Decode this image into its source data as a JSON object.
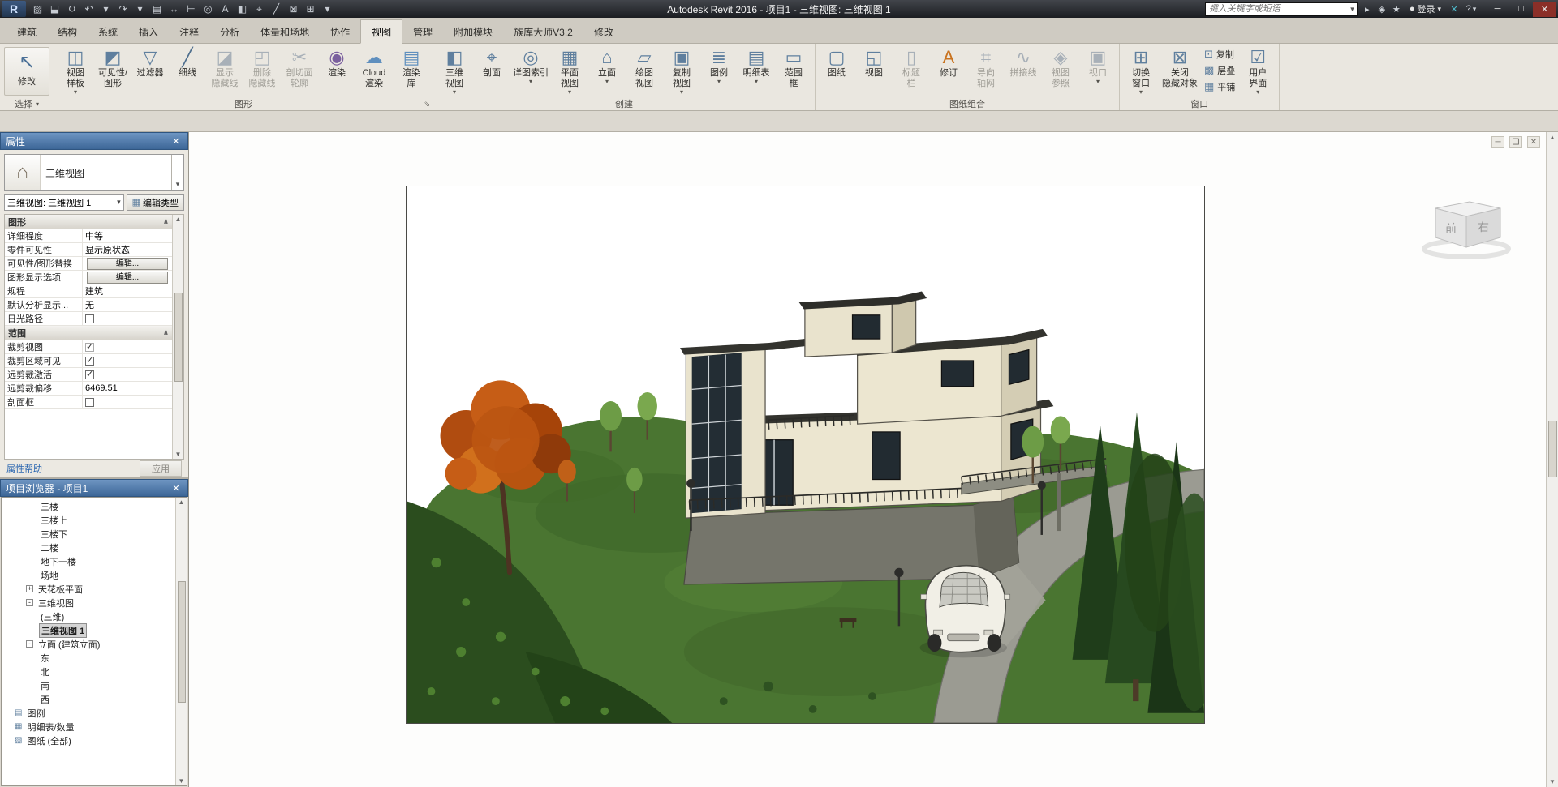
{
  "titlebar": {
    "title": "Autodesk Revit 2016 -   项目1 - 三维视图: 三维视图 1",
    "logo": "R",
    "qat": [
      {
        "icon": "open-icon",
        "glyph": "▨"
      },
      {
        "icon": "save-icon",
        "glyph": "⬓"
      },
      {
        "icon": "sync-icon",
        "glyph": "↻"
      },
      {
        "icon": "undo-icon",
        "glyph": "↶"
      },
      {
        "icon": "undo-caret-icon",
        "glyph": "▾"
      },
      {
        "icon": "redo-icon",
        "glyph": "↷"
      },
      {
        "icon": "redo-caret-icon",
        "glyph": "▾"
      },
      {
        "icon": "print-icon",
        "glyph": "▤"
      },
      {
        "icon": "measure-icon",
        "glyph": "↔"
      },
      {
        "icon": "aligned-dimension-icon",
        "glyph": "⊢"
      },
      {
        "icon": "tag-icon",
        "glyph": "◎"
      },
      {
        "icon": "text-icon",
        "glyph": "A"
      },
      {
        "icon": "default-3d-view-icon",
        "glyph": "◧"
      },
      {
        "icon": "section-icon",
        "glyph": "⌖"
      },
      {
        "icon": "thin-lines-icon",
        "glyph": "╱"
      },
      {
        "icon": "close-hidden-windows-icon",
        "glyph": "⊠"
      },
      {
        "icon": "switch-windows-icon",
        "glyph": "⊞"
      },
      {
        "icon": "qat-customize-icon",
        "glyph": "▾"
      }
    ],
    "search": {
      "placeholder": "键入关键字或短语",
      "caret": "▾"
    },
    "ic_icons": [
      {
        "icon": "search-go-icon",
        "glyph": "▸"
      },
      {
        "icon": "communication-center-icon",
        "glyph": "◈"
      },
      {
        "icon": "favorites-icon",
        "glyph": "★"
      }
    ],
    "sign_in": {
      "icon_glyph": "●",
      "label": "登录",
      "caret": "▾"
    },
    "exchange": {
      "icon": "exchange-apps-icon",
      "glyph": "✕"
    },
    "help": {
      "icon": "help-icon",
      "glyph": "?",
      "caret": "▾"
    },
    "window_buttons": {
      "minimize": "─",
      "maximize": "□",
      "close": "✕"
    }
  },
  "ribbon": {
    "tabs": [
      {
        "label": "建筑"
      },
      {
        "label": "结构"
      },
      {
        "label": "系统"
      },
      {
        "label": "插入"
      },
      {
        "label": "注释"
      },
      {
        "label": "分析"
      },
      {
        "label": "体量和场地"
      },
      {
        "label": "协作"
      },
      {
        "label": "视图",
        "active": true
      },
      {
        "label": "管理"
      },
      {
        "label": "附加模块"
      },
      {
        "label": "族库大师V3.2"
      },
      {
        "label": "修改"
      }
    ],
    "panel_toggle_icon": "▭",
    "panel_toggle_caret": "▾",
    "select_panel": {
      "modify": "修改",
      "caption": "选择",
      "caption_caret": "▾",
      "modify_glyph": "↖"
    },
    "panels": [
      {
        "caption": "图形",
        "launcher": "⇘",
        "buttons": [
          {
            "icon": "view-template-icon",
            "glyph": "◫",
            "color": "#5f7f9e",
            "l1": "视图",
            "l2": "样板",
            "caret": true
          },
          {
            "icon": "visibility-graphics-icon",
            "glyph": "◩",
            "color": "#5f7f9e",
            "l1": "可见性/",
            "l2": "图形"
          },
          {
            "icon": "filters-icon",
            "glyph": "▽",
            "color": "#5f7f9e",
            "l1": "过滤器"
          },
          {
            "icon": "thin-lines-icon",
            "glyph": "╱",
            "color": "#4f6f8e",
            "l1": "细线"
          },
          {
            "icon": "show-hidden-lines-icon",
            "glyph": "◪",
            "color": "#a8b0b8",
            "l1": "显示",
            "l2": "隐藏线",
            "state": "disabled"
          },
          {
            "icon": "remove-hidden-lines-icon",
            "glyph": "◰",
            "color": "#a8b0b8",
            "l1": "删除",
            "l2": "隐藏线",
            "state": "disabled"
          },
          {
            "icon": "cut-profile-icon",
            "glyph": "✂",
            "color": "#a8b0b8",
            "l1": "剖切面",
            "l2": "轮廓",
            "state": "disabled"
          },
          {
            "icon": "render-icon",
            "glyph": "◉",
            "color": "#7a5f9e",
            "l1": "渲染"
          },
          {
            "icon": "render-in-cloud-icon",
            "glyph": "☁",
            "color": "#5f8fbe",
            "l1": "Cloud",
            "l2": "渲染"
          },
          {
            "icon": "render-gallery-icon",
            "glyph": "▤",
            "color": "#5f8fbe",
            "l1": "渲染",
            "l2": "库"
          }
        ]
      },
      {
        "caption": "创建",
        "buttons": [
          {
            "icon": "default-3d-view-icon",
            "glyph": "◧",
            "color": "#5f7f9e",
            "l1": "三维",
            "l2": "视图",
            "caret": true
          },
          {
            "icon": "section-icon",
            "glyph": "⌖",
            "color": "#5f7f9e",
            "l1": "剖面"
          },
          {
            "icon": "callout-icon",
            "glyph": "◎",
            "color": "#5f7f9e",
            "l1": "详图索引",
            "caret": true
          },
          {
            "icon": "plan-views-icon",
            "glyph": "▦",
            "color": "#5f7f9e",
            "l1": "平面",
            "l2": "视图",
            "caret": true
          },
          {
            "icon": "elevation-icon",
            "glyph": "⌂",
            "color": "#5f7f9e",
            "l1": "立面",
            "caret": true
          },
          {
            "icon": "drafting-view-icon",
            "glyph": "▱",
            "color": "#5f7f9e",
            "l1": "绘图",
            "l2": "视图"
          },
          {
            "icon": "duplicate-view-icon",
            "glyph": "▣",
            "color": "#5f7f9e",
            "l1": "复制",
            "l2": "视图",
            "caret": true
          },
          {
            "icon": "legends-icon",
            "glyph": "≣",
            "color": "#5f7f9e",
            "l1": "图例",
            "caret": true
          },
          {
            "icon": "schedules-icon",
            "glyph": "▤",
            "color": "#5f7f9e",
            "l1": "明细表",
            "caret": true
          },
          {
            "icon": "scope-box-icon",
            "glyph": "▭",
            "color": "#5f7f9e",
            "l1": "范围",
            "l2": "框"
          }
        ]
      },
      {
        "caption": "图纸组合",
        "buttons": [
          {
            "icon": "sheet-icon",
            "glyph": "▢",
            "color": "#5f7f9e",
            "l1": "图纸"
          },
          {
            "icon": "view-icon",
            "glyph": "◱",
            "color": "#5f7f9e",
            "l1": "视图"
          },
          {
            "icon": "title-block-icon",
            "glyph": "▯",
            "color": "#a8b0b8",
            "l1": "标题",
            "l2": "栏",
            "state": "disabled"
          },
          {
            "icon": "revisions-icon",
            "glyph": "A",
            "color": "#c9731f",
            "l1": "修订"
          },
          {
            "icon": "guide-grid-icon",
            "glyph": "⌗",
            "color": "#a8b0b8",
            "l1": "导向",
            "l2": "轴网",
            "state": "disabled"
          },
          {
            "icon": "matchline-icon",
            "glyph": "∿",
            "color": "#a8b0b8",
            "l1": "拼接线",
            "state": "disabled"
          },
          {
            "icon": "view-reference-icon",
            "glyph": "◈",
            "color": "#a8b0b8",
            "l1": "视图",
            "l2": "参照",
            "state": "disabled"
          },
          {
            "icon": "viewports-icon",
            "glyph": "▣",
            "color": "#a8b0b8",
            "l1": "视口",
            "caret": true,
            "state": "disabled"
          }
        ]
      },
      {
        "caption": "窗口",
        "buttons": [
          {
            "icon": "switch-windows-icon",
            "glyph": "⊞",
            "color": "#5f7f9e",
            "l1": "切换",
            "l2": "窗口",
            "caret": true
          },
          {
            "icon": "close-hidden-icon",
            "glyph": "⊠",
            "color": "#5f7f9e",
            "l1": "关闭",
            "l2": "隐藏对象"
          }
        ],
        "small_buttons": [
          {
            "icon": "replicate-icon",
            "glyph": "⊡",
            "color": "#5f7f9e",
            "label": "复制"
          },
          {
            "icon": "cascade-icon",
            "glyph": "▩",
            "color": "#5f7f9e",
            "label": "层叠"
          },
          {
            "icon": "tile-icon",
            "glyph": "▦",
            "color": "#5f7f9e",
            "label": "平铺"
          }
        ],
        "buttons2": [
          {
            "icon": "user-interface-icon",
            "glyph": "☑",
            "color": "#5f7f9e",
            "l1": "用户",
            "l2": "界面",
            "caret": true
          }
        ]
      }
    ]
  },
  "properties": {
    "title": "属性",
    "close_glyph": "✕",
    "type_selector": {
      "label": "三维视图",
      "thumb_glyph": "⌂",
      "drop_caret": "▾"
    },
    "instance_combo": "三维视图: 三维视图 1",
    "combo_caret": "▾",
    "edit_type": "编辑类型",
    "edit_type_glyph": "▦",
    "groups": [
      {
        "name": "图形",
        "collapse_glyph": "∧",
        "rows": [
          {
            "label": "详细程度",
            "value": "中等",
            "type": "text"
          },
          {
            "label": "零件可见性",
            "value": "显示原状态",
            "type": "text"
          },
          {
            "label": "可见性/图形替换",
            "value": "编辑...",
            "type": "button"
          },
          {
            "label": "图形显示选项",
            "value": "编辑...",
            "type": "button"
          },
          {
            "label": "规程",
            "value": "建筑",
            "type": "text"
          },
          {
            "label": "默认分析显示...",
            "value": "无",
            "type": "text"
          },
          {
            "label": "日光路径",
            "type": "check",
            "checked": false
          }
        ]
      },
      {
        "name": "范围",
        "collapse_glyph": "∧",
        "rows": [
          {
            "label": "裁剪视图",
            "type": "check",
            "checked": true,
            "state": "disabled"
          },
          {
            "label": "裁剪区域可见",
            "type": "check",
            "checked": true
          },
          {
            "label": "远剪裁激活",
            "type": "check",
            "checked": true
          },
          {
            "label": "远剪裁偏移",
            "value": "6469.51",
            "type": "text"
          },
          {
            "label": "剖面框",
            "type": "check",
            "checked": false
          }
        ]
      }
    ],
    "help_link": "属性帮助",
    "apply_button": "应用"
  },
  "project_browser": {
    "title": "项目浏览器 - 项目1",
    "close_glyph": "✕",
    "items": [
      {
        "label": "三楼",
        "indent": 3
      },
      {
        "label": "三楼上",
        "indent": 3
      },
      {
        "label": "三楼下",
        "indent": 3
      },
      {
        "label": "二楼",
        "indent": 3
      },
      {
        "label": "地下一楼",
        "indent": 3
      },
      {
        "label": "场地",
        "indent": 3
      },
      {
        "label": "天花板平面",
        "indent": 2,
        "exp": "+"
      },
      {
        "label": "三维视图",
        "indent": 2,
        "exp": "-"
      },
      {
        "label": "(三维)",
        "indent": 3
      },
      {
        "label": "三维视图 1",
        "indent": 3,
        "selected": true
      },
      {
        "label": "立面 (建筑立面)",
        "indent": 2,
        "exp": "-"
      },
      {
        "label": "东",
        "indent": 3
      },
      {
        "label": "北",
        "indent": 3
      },
      {
        "label": "南",
        "indent": 3
      },
      {
        "label": "西",
        "indent": 3
      },
      {
        "label": "图例",
        "indent": 1,
        "glyph": "▤"
      },
      {
        "label": "明细表/数量",
        "indent": 1,
        "glyph": "▦"
      },
      {
        "label": "图纸 (全部)",
        "indent": 1,
        "glyph": "▧"
      }
    ]
  },
  "canvas": {
    "view_controls": [
      {
        "icon": "view-minimize-icon",
        "glyph": "─"
      },
      {
        "icon": "view-restore-icon",
        "glyph": "❑"
      },
      {
        "icon": "view-close-icon",
        "glyph": "✕"
      }
    ],
    "viewcube": {
      "front": "前",
      "right": "右"
    }
  }
}
